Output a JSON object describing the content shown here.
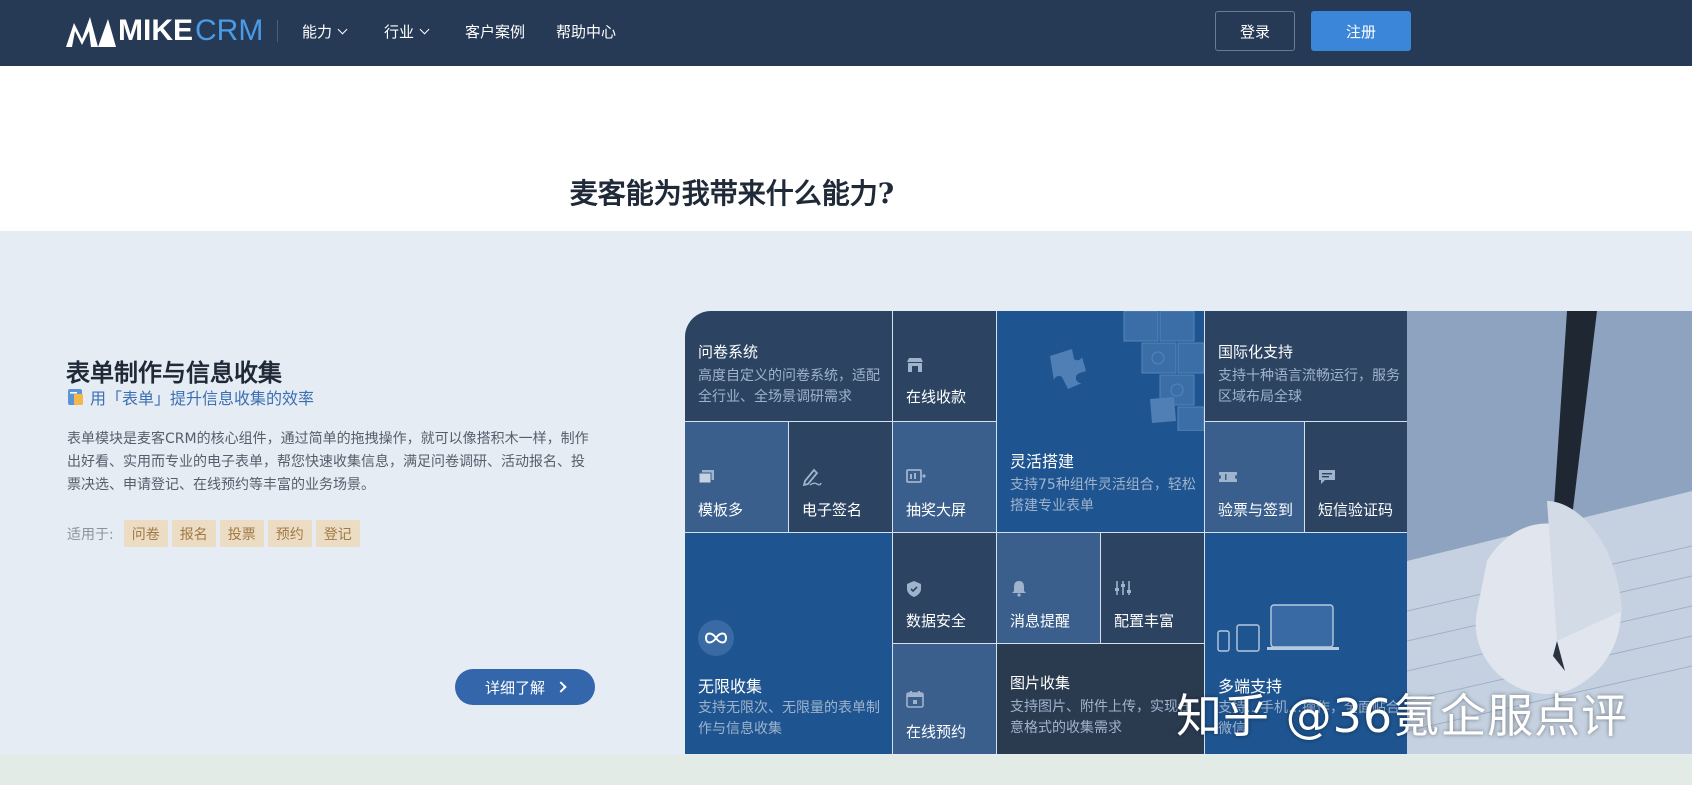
{
  "nav": {
    "logo_mike": "MIKE",
    "logo_crm": "CRM",
    "items": [
      {
        "label": "能力",
        "dropdown": true
      },
      {
        "label": "行业",
        "dropdown": true
      },
      {
        "label": "客户案例",
        "dropdown": false
      },
      {
        "label": "帮助中心",
        "dropdown": false
      }
    ],
    "login": "登录",
    "register": "注册"
  },
  "headline": "麦客能为我带来什么能力?",
  "feature": {
    "title": "表单制作与信息收集",
    "subtitle": "用「表单」提升信息收集的效率",
    "description": "表单模块是麦客CRM的核心组件，通过简单的拖拽操作，就可以像搭积木一样，制作出好看、实用而专业的电子表单，帮您快速收集信息，满足问卷调研、活动报名、投票决选、申请登记、在线预约等丰富的业务场景。",
    "use_label": "适用于:",
    "tags": [
      "问卷",
      "报名",
      "投票",
      "预约",
      "登记"
    ],
    "more_button": "详细了解"
  },
  "tiles": {
    "survey": {
      "title": "问卷系统",
      "desc": "高度自定义的问卷系统，适配全行业、全场景调研需求"
    },
    "payment": {
      "title": "在线收款",
      "icon": "store-icon"
    },
    "builder": {
      "title": "灵活搭建",
      "desc": "支持75种组件灵活组合，轻松搭建专业表单",
      "icon": "puzzle-icon"
    },
    "i18n": {
      "title": "国际化支持",
      "desc": "支持十种语言流畅运行，服务区域布局全球"
    },
    "templates": {
      "title": "模板多",
      "icon": "layers-icon"
    },
    "esign": {
      "title": "电子签名",
      "icon": "pen-icon"
    },
    "lottery": {
      "title": "抽奖大屏",
      "icon": "screen-icon"
    },
    "ticket": {
      "title": "验票与签到",
      "icon": "ticket-icon"
    },
    "sms": {
      "title": "短信验证码",
      "icon": "message-icon"
    },
    "unlimited": {
      "title": "无限收集",
      "desc": "支持无限次、无限量的表单制作与信息收集",
      "icon": "infinity-icon"
    },
    "security": {
      "title": "数据安全",
      "icon": "shield-icon"
    },
    "notify": {
      "title": "消息提醒",
      "icon": "bell-icon"
    },
    "config": {
      "title": "配置丰富",
      "icon": "sliders-icon"
    },
    "multi": {
      "title": "多端支持",
      "desc": "支持…手机…操作，全面贴合微信",
      "icon": "devices-icon"
    },
    "booking": {
      "title": "在线预约",
      "icon": "calendar-icon"
    },
    "images": {
      "title": "图片收集",
      "desc": "支持图片、附件上传，实现任意格式的收集需求"
    }
  },
  "watermark": "知乎 @36氪企服点评",
  "colors": {
    "nav_bg": "#263a55",
    "accent": "#3b86d8",
    "section_bg": "#e6ecf4",
    "tile_dark": "#2c4462",
    "tile_blue": "#1e5490",
    "tile_mid": "#3a5f8d",
    "tag_bg": "#ecdcc3"
  }
}
